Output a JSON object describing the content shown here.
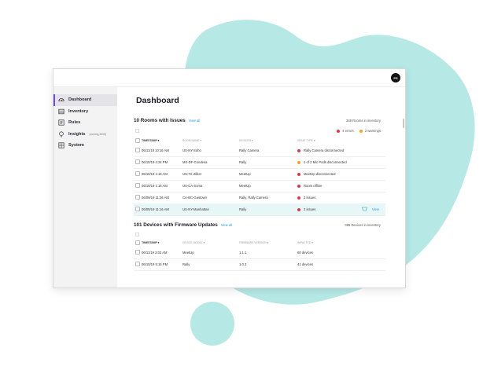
{
  "colors": {
    "blob": "#b6e9e6",
    "accent": "#6b4fd8",
    "link": "#2196f3",
    "error": "#e0374a",
    "warning": "#f5a623",
    "highlight_row": "#e7f7f8"
  },
  "header": {
    "avatar_initials": "PS"
  },
  "sidebar": {
    "items": [
      {
        "label": "Dashboard",
        "icon": "dashboard-icon",
        "active": true
      },
      {
        "label": "Inventory",
        "icon": "inventory-icon"
      },
      {
        "label": "Rules",
        "icon": "rules-icon"
      },
      {
        "label": "Insights",
        "sub": "(coming 2020)",
        "icon": "insights-icon"
      },
      {
        "label": "System",
        "icon": "system-icon"
      }
    ]
  },
  "main": {
    "title": "Dashboard"
  },
  "rooms": {
    "title": "10 Rooms with Issues",
    "link": "View all",
    "count": "348 Rooms in inventory",
    "errors": "4 errors",
    "warnings": "2 warnings",
    "columns": [
      "TIMESTAMP ▾",
      "ROOM NAME ▾",
      "DEVICES ▾",
      "ISSUE TYPE ▾"
    ],
    "rows": [
      {
        "timestamp": "06/11/19 10:16 AM",
        "room": "US-NY-Soho",
        "devices": "Rally Camera",
        "issue": "Rally Camera disconnected",
        "status": "error"
      },
      {
        "timestamp": "06/10/19 4:24 PM",
        "room": "MX-DF-Condesa",
        "devices": "Rally",
        "issue": "1 of 2 Mic Pods disconnected",
        "status": "warning"
      },
      {
        "timestamp": "06/10/19 1:16 AM",
        "room": "US-TX-Zilker",
        "devices": "MeetUp",
        "issue": "MeetUp disconnected",
        "status": "error"
      },
      {
        "timestamp": "06/10/19 1:16 AM",
        "room": "US-CA-Soma",
        "devices": "MeetUp",
        "issue": "Room offline",
        "status": "error"
      },
      {
        "timestamp": "06/09/19 11:36 AM",
        "room": "CA-BC-Gastown",
        "devices": "Rally, Rally Camera",
        "issue": "2 issues",
        "status": "error"
      },
      {
        "timestamp": "06/09/19 11:16 AM",
        "room": "US-NY-Manhattan",
        "devices": "Rally",
        "issue": "2 issues",
        "status": "error",
        "highlight": true,
        "action": "View"
      }
    ]
  },
  "firmware": {
    "title": "101 Devices with Firmware Updates",
    "link": "View all",
    "count": "365 Devices in inventory",
    "columns": [
      "TIMESTAMP ▾",
      "DEVICE MODEL ▾",
      "FIRMWARE VERSION ▾",
      "IMPACTED ▾"
    ],
    "rows": [
      {
        "timestamp": "06/11/19 2:03 AM",
        "model": "MeetUp",
        "version": "1.1.1",
        "impacted": "60 devices"
      },
      {
        "timestamp": "06/10/19 5:15 PM",
        "model": "Rally",
        "version": "1.0.3",
        "impacted": "41 devices"
      }
    ]
  }
}
